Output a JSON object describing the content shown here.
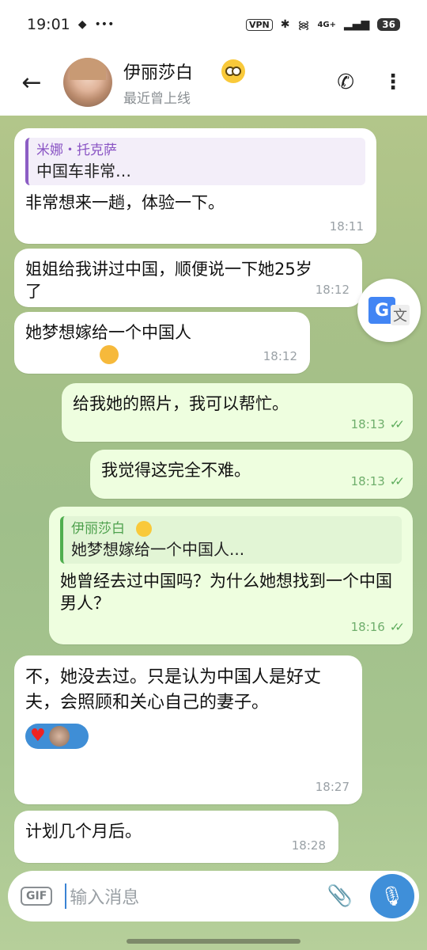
{
  "status_bar": {
    "time": "19:01",
    "vpn": "VPN",
    "network": "4G+",
    "battery": "36"
  },
  "header": {
    "contact_name": "伊丽莎白",
    "contact_status": "最近曾上线"
  },
  "messages": [
    {
      "direction": "in",
      "reply_author": "米娜・托克萨",
      "reply_text": "中国车非常…",
      "text": "非常想来一趟，体验一下。",
      "time": "18:11"
    },
    {
      "direction": "in",
      "text": "姐姐给我讲过中国，顺便说一下她25岁了",
      "time": "18:12"
    },
    {
      "direction": "in",
      "text": "她梦想嫁给一个中国人",
      "time": "18:12"
    },
    {
      "direction": "out",
      "text": "给我她的照片，我可以帮忙。",
      "time": "18:13"
    },
    {
      "direction": "out",
      "text": "我觉得这完全不难。",
      "time": "18:13"
    },
    {
      "direction": "out",
      "reply_author": "伊丽莎白",
      "reply_text": "她梦想嫁给一个中国人...",
      "text": "她曾经去过中国吗？为什么她想找到一个中国男人？",
      "time": "18:16"
    },
    {
      "direction": "in",
      "text": "不，她没去过。只是认为中国人是好丈夫，会照顾和关心自己的妻子。",
      "time": "18:27"
    },
    {
      "direction": "in",
      "text": "计划几个月后。",
      "time": "18:28"
    }
  ],
  "composer": {
    "gif_label": "GIF",
    "placeholder": "输入消息"
  },
  "translate": {
    "g": "G",
    "wen": "文"
  }
}
